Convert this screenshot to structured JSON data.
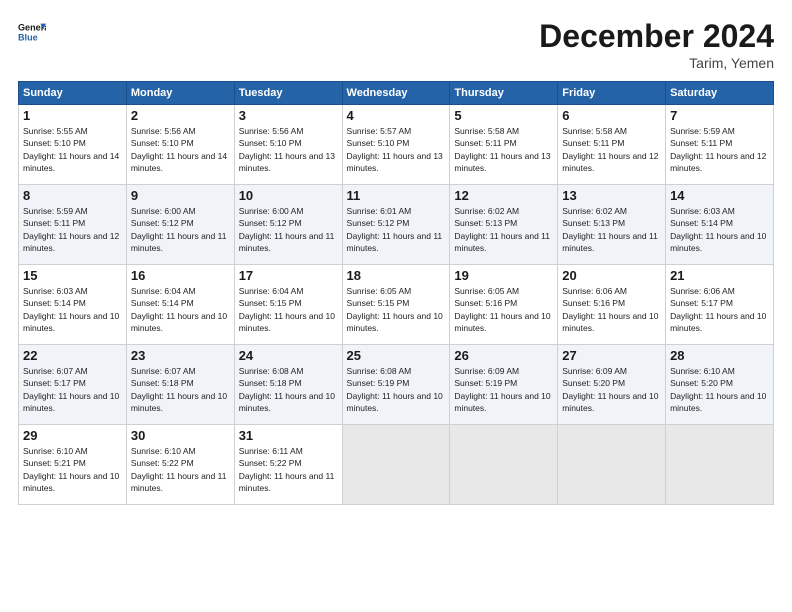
{
  "logo": {
    "line1": "General",
    "line2": "Blue"
  },
  "header": {
    "month": "December 2024",
    "location": "Tarim, Yemen"
  },
  "weekdays": [
    "Sunday",
    "Monday",
    "Tuesday",
    "Wednesday",
    "Thursday",
    "Friday",
    "Saturday"
  ],
  "weeks": [
    [
      {
        "day": 1,
        "sunrise": "5:55 AM",
        "sunset": "5:10 PM",
        "daylight": "11 hours and 14 minutes."
      },
      {
        "day": 2,
        "sunrise": "5:56 AM",
        "sunset": "5:10 PM",
        "daylight": "11 hours and 14 minutes."
      },
      {
        "day": 3,
        "sunrise": "5:56 AM",
        "sunset": "5:10 PM",
        "daylight": "11 hours and 13 minutes."
      },
      {
        "day": 4,
        "sunrise": "5:57 AM",
        "sunset": "5:10 PM",
        "daylight": "11 hours and 13 minutes."
      },
      {
        "day": 5,
        "sunrise": "5:58 AM",
        "sunset": "5:11 PM",
        "daylight": "11 hours and 13 minutes."
      },
      {
        "day": 6,
        "sunrise": "5:58 AM",
        "sunset": "5:11 PM",
        "daylight": "11 hours and 12 minutes."
      },
      {
        "day": 7,
        "sunrise": "5:59 AM",
        "sunset": "5:11 PM",
        "daylight": "11 hours and 12 minutes."
      }
    ],
    [
      {
        "day": 8,
        "sunrise": "5:59 AM",
        "sunset": "5:11 PM",
        "daylight": "11 hours and 12 minutes."
      },
      {
        "day": 9,
        "sunrise": "6:00 AM",
        "sunset": "5:12 PM",
        "daylight": "11 hours and 11 minutes."
      },
      {
        "day": 10,
        "sunrise": "6:00 AM",
        "sunset": "5:12 PM",
        "daylight": "11 hours and 11 minutes."
      },
      {
        "day": 11,
        "sunrise": "6:01 AM",
        "sunset": "5:12 PM",
        "daylight": "11 hours and 11 minutes."
      },
      {
        "day": 12,
        "sunrise": "6:02 AM",
        "sunset": "5:13 PM",
        "daylight": "11 hours and 11 minutes."
      },
      {
        "day": 13,
        "sunrise": "6:02 AM",
        "sunset": "5:13 PM",
        "daylight": "11 hours and 11 minutes."
      },
      {
        "day": 14,
        "sunrise": "6:03 AM",
        "sunset": "5:14 PM",
        "daylight": "11 hours and 10 minutes."
      }
    ],
    [
      {
        "day": 15,
        "sunrise": "6:03 AM",
        "sunset": "5:14 PM",
        "daylight": "11 hours and 10 minutes."
      },
      {
        "day": 16,
        "sunrise": "6:04 AM",
        "sunset": "5:14 PM",
        "daylight": "11 hours and 10 minutes."
      },
      {
        "day": 17,
        "sunrise": "6:04 AM",
        "sunset": "5:15 PM",
        "daylight": "11 hours and 10 minutes."
      },
      {
        "day": 18,
        "sunrise": "6:05 AM",
        "sunset": "5:15 PM",
        "daylight": "11 hours and 10 minutes."
      },
      {
        "day": 19,
        "sunrise": "6:05 AM",
        "sunset": "5:16 PM",
        "daylight": "11 hours and 10 minutes."
      },
      {
        "day": 20,
        "sunrise": "6:06 AM",
        "sunset": "5:16 PM",
        "daylight": "11 hours and 10 minutes."
      },
      {
        "day": 21,
        "sunrise": "6:06 AM",
        "sunset": "5:17 PM",
        "daylight": "11 hours and 10 minutes."
      }
    ],
    [
      {
        "day": 22,
        "sunrise": "6:07 AM",
        "sunset": "5:17 PM",
        "daylight": "11 hours and 10 minutes."
      },
      {
        "day": 23,
        "sunrise": "6:07 AM",
        "sunset": "5:18 PM",
        "daylight": "11 hours and 10 minutes."
      },
      {
        "day": 24,
        "sunrise": "6:08 AM",
        "sunset": "5:18 PM",
        "daylight": "11 hours and 10 minutes."
      },
      {
        "day": 25,
        "sunrise": "6:08 AM",
        "sunset": "5:19 PM",
        "daylight": "11 hours and 10 minutes."
      },
      {
        "day": 26,
        "sunrise": "6:09 AM",
        "sunset": "5:19 PM",
        "daylight": "11 hours and 10 minutes."
      },
      {
        "day": 27,
        "sunrise": "6:09 AM",
        "sunset": "5:20 PM",
        "daylight": "11 hours and 10 minutes."
      },
      {
        "day": 28,
        "sunrise": "6:10 AM",
        "sunset": "5:20 PM",
        "daylight": "11 hours and 10 minutes."
      }
    ],
    [
      {
        "day": 29,
        "sunrise": "6:10 AM",
        "sunset": "5:21 PM",
        "daylight": "11 hours and 10 minutes."
      },
      {
        "day": 30,
        "sunrise": "6:10 AM",
        "sunset": "5:22 PM",
        "daylight": "11 hours and 11 minutes."
      },
      {
        "day": 31,
        "sunrise": "6:11 AM",
        "sunset": "5:22 PM",
        "daylight": "11 hours and 11 minutes."
      },
      null,
      null,
      null,
      null
    ]
  ]
}
